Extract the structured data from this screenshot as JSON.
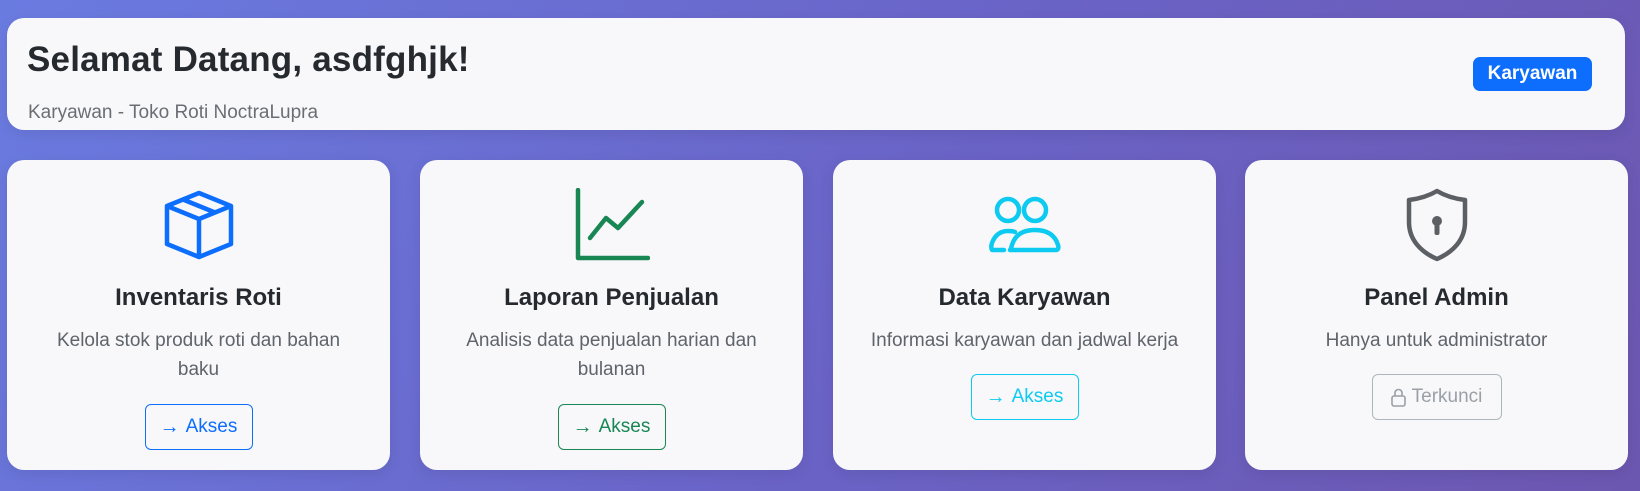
{
  "header": {
    "title": "Selamat Datang, asdfghjk!",
    "subtitle": "Karyawan - Toko Roti NoctraLupra",
    "role_badge": "Karyawan"
  },
  "cards": [
    {
      "icon": "box-icon",
      "title": "Inventaris Roti",
      "description": "Kelola stok produk roti dan bahan baku",
      "button_icon": "→",
      "button_label": "Akses",
      "color": "#0d6efd"
    },
    {
      "icon": "line-chart-icon",
      "title": "Laporan Penjualan",
      "description": "Analisis data penjualan harian dan bulanan",
      "button_icon": "→",
      "button_label": "Akses",
      "color": "#198754"
    },
    {
      "icon": "people-icon",
      "title": "Data Karyawan",
      "description": "Informasi karyawan dan jadwal kerja",
      "button_icon": "→",
      "button_label": "Akses",
      "color": "#0dcaf0"
    },
    {
      "icon": "shield-lock-icon",
      "title": "Panel Admin",
      "description": "Hanya untuk administrator",
      "button_icon": "lock-icon",
      "button_label": "Terkunci",
      "color": "#5c5f63"
    }
  ]
}
